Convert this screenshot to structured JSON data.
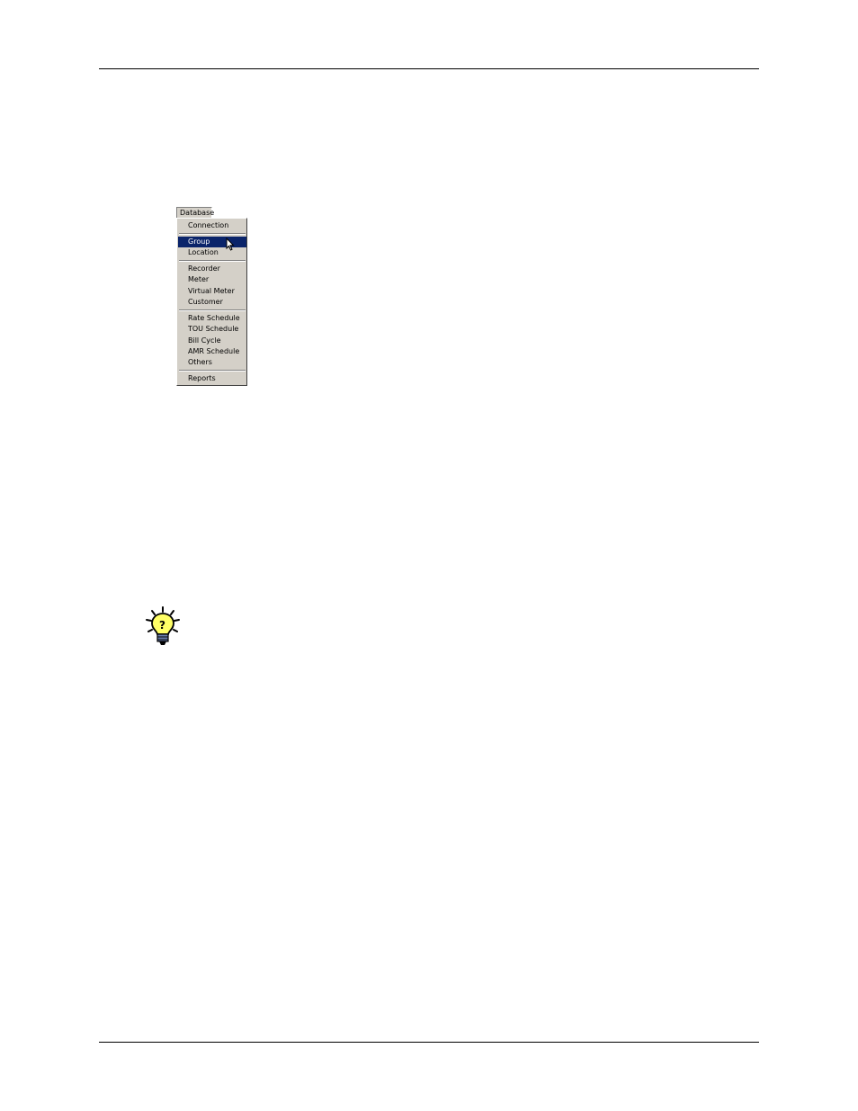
{
  "menu": {
    "title": "Database",
    "groups": [
      [
        "Connection"
      ],
      [
        "Group",
        "Location"
      ],
      [
        "Recorder",
        "Meter",
        "Virtual Meter",
        "Customer"
      ],
      [
        "Rate Schedule",
        "TOU Schedule",
        "Bill Cycle",
        "AMR Schedule",
        "Others"
      ],
      [
        "Reports"
      ]
    ],
    "highlighted": "Group",
    "colors": {
      "menu_bg": "#d4d0c8",
      "highlight_bg": "#0a246a",
      "highlight_text": "#ffffff"
    }
  },
  "icons": {
    "cursor": "arrow-cursor-icon",
    "tip": "lightbulb-tip-icon"
  }
}
